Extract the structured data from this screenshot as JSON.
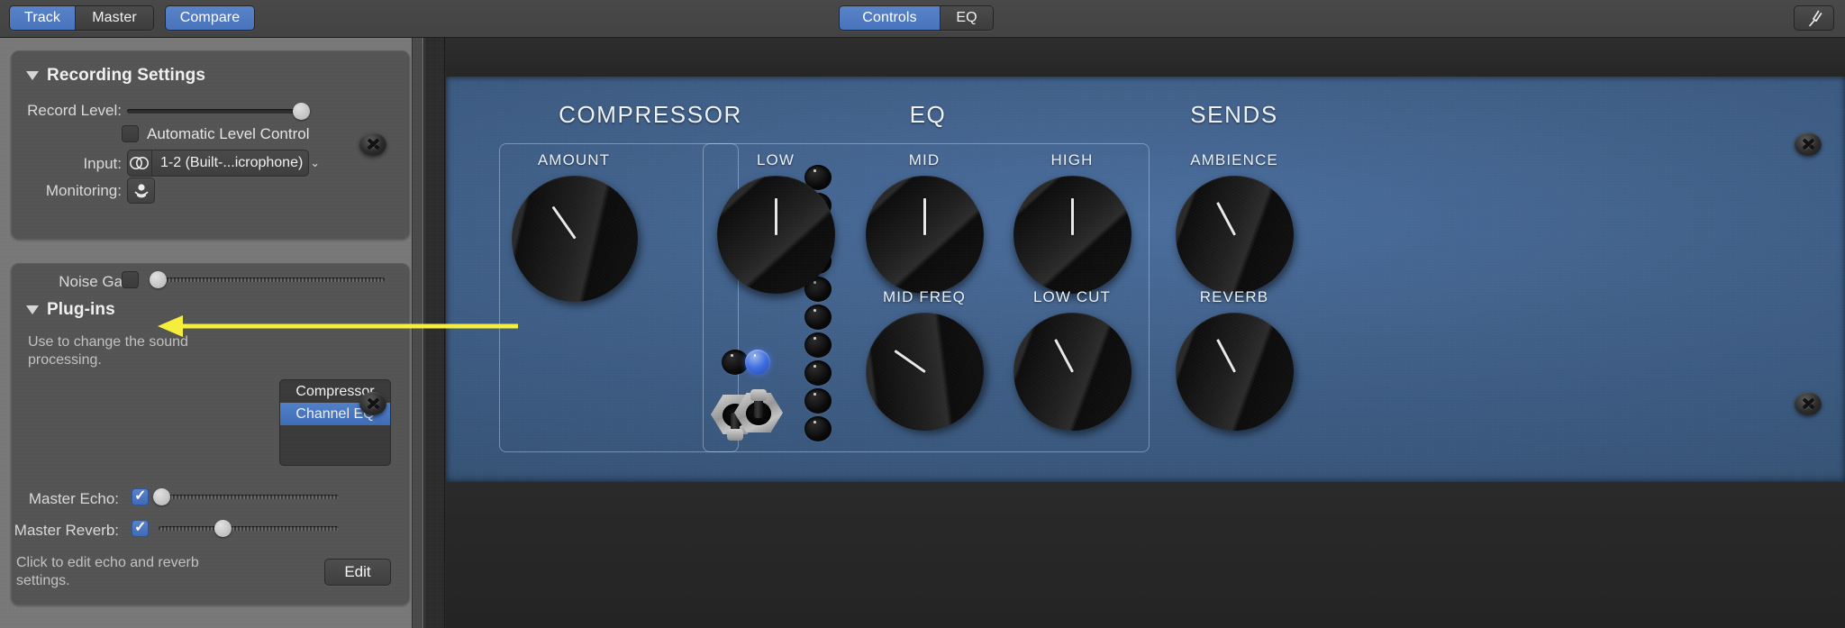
{
  "toolbar": {
    "left_segments": [
      {
        "label": "Track",
        "active": true
      },
      {
        "label": "Master",
        "active": false
      }
    ],
    "compare_label": "Compare",
    "center_segments": [
      {
        "label": "Controls",
        "active": true
      },
      {
        "label": "EQ",
        "active": false
      }
    ],
    "tuner_icon": "tuning-fork-icon",
    "accent_color": "#4874bd"
  },
  "sidebar": {
    "recording": {
      "title": "Recording Settings",
      "record_level_label": "Record Level:",
      "record_level_value": 100,
      "auto_level_label": "Automatic Level Control",
      "auto_level_checked": false,
      "input_label": "Input:",
      "input_value": "1-2  (Built-...icrophone)",
      "input_icon": "stereo-pair-icon",
      "monitoring_label": "Monitoring:",
      "monitoring_icon": "monitoring-icon"
    },
    "plugins": {
      "noise_gate_label": "Noise Gate:",
      "noise_gate_checked": false,
      "noise_gate_value": 0,
      "title": "Plug-ins",
      "help": "Use to change the sound processing.",
      "list": [
        {
          "label": "Compressor",
          "selected": false
        },
        {
          "label": "Channel EQ",
          "selected": true
        }
      ],
      "master_echo_label": "Master Echo:",
      "master_echo_checked": true,
      "master_echo_value": 2,
      "master_reverb_label": "Master Reverb:",
      "master_reverb_checked": true,
      "master_reverb_value": 35,
      "edit_help": "Click to edit echo and reverb settings.",
      "edit_label": "Edit"
    }
  },
  "rack": {
    "panel_color": "#3e5d85",
    "sections": [
      {
        "name": "compressor",
        "heading": "COMPRESSOR",
        "knobs": [
          {
            "label": "AMOUNT",
            "angle": -35
          }
        ],
        "led_on": false,
        "toggle_state": "down",
        "meter_leds": 10,
        "meter_lit": 0
      },
      {
        "name": "eq",
        "heading": "EQ",
        "knobs": [
          {
            "label": "LOW",
            "angle": 0
          },
          {
            "label": "MID",
            "angle": 0
          },
          {
            "label": "HIGH",
            "angle": 0
          },
          {
            "label": "MID FREQ",
            "angle": -55
          },
          {
            "label": "LOW CUT",
            "angle": -28
          }
        ],
        "led_on": true,
        "toggle_state": "up"
      },
      {
        "name": "sends",
        "heading": "SENDS",
        "knobs": [
          {
            "label": "AMBIENCE",
            "angle": -28
          },
          {
            "label": "REVERB",
            "angle": -28
          }
        ]
      }
    ]
  },
  "annotation": {
    "arrow_color": "#f5ee3c",
    "target": "Plug-ins"
  }
}
